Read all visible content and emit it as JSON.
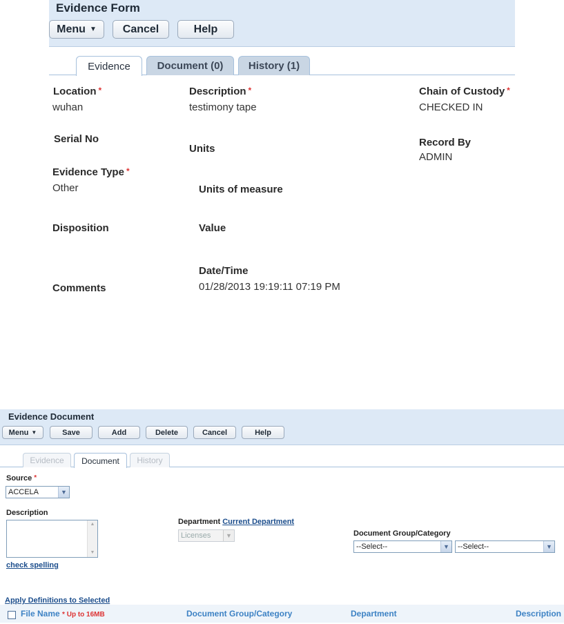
{
  "evidence_form": {
    "title": "Evidence Form",
    "buttons": {
      "menu": "Menu",
      "cancel": "Cancel",
      "help": "Help"
    },
    "tabs": {
      "evidence": "Evidence",
      "document": "Document (0)",
      "history": "History (1)"
    },
    "fields": {
      "location": {
        "label": "Location",
        "value": "wuhan"
      },
      "description": {
        "label": "Description",
        "value": "testimony tape"
      },
      "chain_of_custody": {
        "label": "Chain of Custody",
        "value": "CHECKED IN"
      },
      "serial_no": {
        "label": "Serial No"
      },
      "units": {
        "label": "Units"
      },
      "record_by": {
        "label": "Record By",
        "value": "ADMIN"
      },
      "evidence_type": {
        "label": "Evidence Type",
        "value": "Other"
      },
      "units_of_measure": {
        "label": "Units of measure"
      },
      "disposition": {
        "label": "Disposition"
      },
      "value": {
        "label": "Value"
      },
      "date_time": {
        "label": "Date/Time",
        "value": "01/28/2013 19:19:11 07:19 PM"
      },
      "comments": {
        "label": "Comments"
      }
    },
    "required_marker": "*"
  },
  "evidence_document": {
    "title": "Evidence Document",
    "buttons": {
      "menu": "Menu",
      "save": "Save",
      "add": "Add",
      "delete": "Delete",
      "cancel": "Cancel",
      "help": "Help"
    },
    "tabs": {
      "evidence": "Evidence",
      "document": "Document",
      "history": "History"
    },
    "source": {
      "label": "Source",
      "value": "ACCELA"
    },
    "description": {
      "label": "Description",
      "value": ""
    },
    "check_spelling": "check spelling",
    "department": {
      "label": "Department",
      "link": "Current Department",
      "value": "Licenses"
    },
    "doc_group": {
      "label": "Document Group/Category",
      "group_value": "--Select--",
      "category_value": "--Select--"
    },
    "apply_definitions": "Apply Definitions to Selected",
    "table": {
      "columns": {
        "file_name": "File Name",
        "size_note": "* Up to 16MB",
        "group": "Document Group/Category",
        "department": "Department",
        "description": "Description"
      }
    }
  }
}
